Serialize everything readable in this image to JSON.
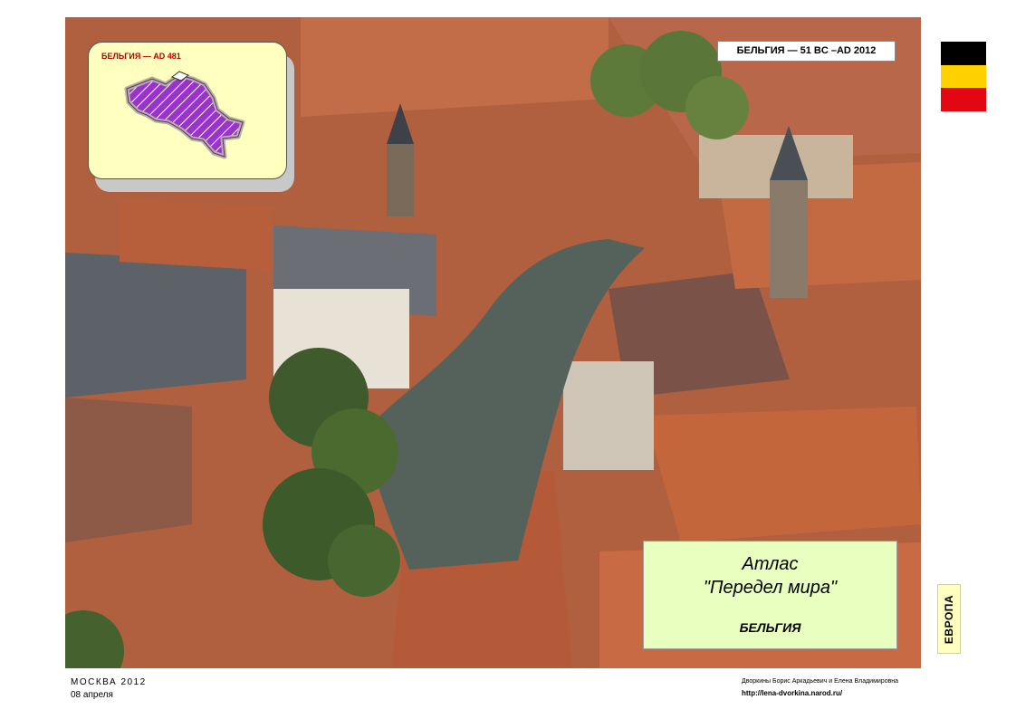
{
  "inset": {
    "title": "БЕЛЬГИЯ — AD 481",
    "map_fill": "#9933cc"
  },
  "header_tag": "БЕЛЬГИЯ — 51 BC –AD 2012",
  "flag": {
    "colors": [
      "#000000",
      "#ffd100",
      "#e30613"
    ]
  },
  "title_box": {
    "line1": "Атлас",
    "line2": "\"Передел мира\"",
    "line3": "БЕЛЬГИЯ"
  },
  "side_label": "ЕВРОПА",
  "footer": {
    "city_year": "МОСКВА   2012",
    "date": "08 апреля",
    "authors": "Дворкины Борис Аркадьевич и Елена Владимировна",
    "url": "http://lena-dvorkina.narod.ru/"
  }
}
